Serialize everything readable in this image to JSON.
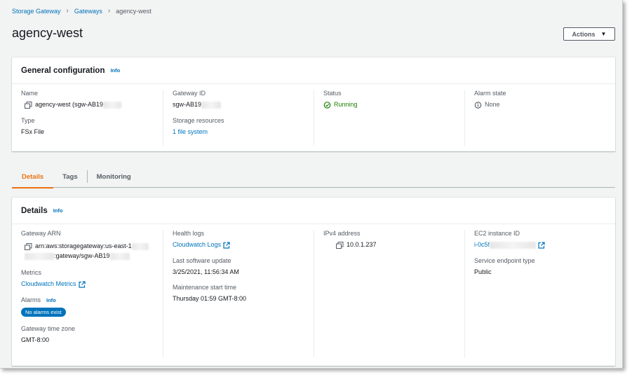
{
  "breadcrumb": {
    "items": [
      "Storage Gateway",
      "Gateways"
    ],
    "current": "agency-west"
  },
  "page": {
    "title": "agency-west",
    "actions_label": "Actions"
  },
  "general": {
    "title": "General configuration",
    "info": "Info",
    "name_label": "Name",
    "name_value": "agency-west (sgw-AB19",
    "type_label": "Type",
    "type_value": "FSx File",
    "gateway_id_label": "Gateway ID",
    "gateway_id_value": "sgw-AB19",
    "storage_label": "Storage resources",
    "storage_value": "1 file system",
    "status_label": "Status",
    "status_value": "Running",
    "alarm_label": "Alarm state",
    "alarm_value": "None"
  },
  "tabs": [
    "Details",
    "Tags",
    "Monitoring"
  ],
  "details": {
    "title": "Details",
    "info": "Info",
    "arn_label": "Gateway ARN",
    "arn_line1": "arn:aws:storagegateway:us-east-1",
    "arn_line2": ":gateway/sgw-AB19",
    "metrics_label": "Metrics",
    "metrics_link": "Cloudwatch Metrics",
    "alarms_label": "Alarms",
    "alarms_info": "Info",
    "alarms_badge": "No alarms exist",
    "timezone_label": "Gateway time zone",
    "timezone_value": "GMT-8:00",
    "health_label": "Health logs",
    "health_link": "Cloudwatch Logs",
    "update_label": "Last software update",
    "update_value": "3/25/2021, 11:56:34 AM",
    "maint_label": "Maintenance start time",
    "maint_value": "Thursday 01:59 GMT-8:00",
    "ipv4_label": "IPv4 address",
    "ipv4_value": "10.0.1.237",
    "ec2_label": "EC2 instance ID",
    "ec2_value": "i-0c5f",
    "endpoint_label": "Service endpoint type",
    "endpoint_value": "Public"
  },
  "colors": {
    "link": "#0073bb",
    "active_tab": "#ec7211",
    "success": "#1d8102",
    "badge": "#0073bb"
  }
}
